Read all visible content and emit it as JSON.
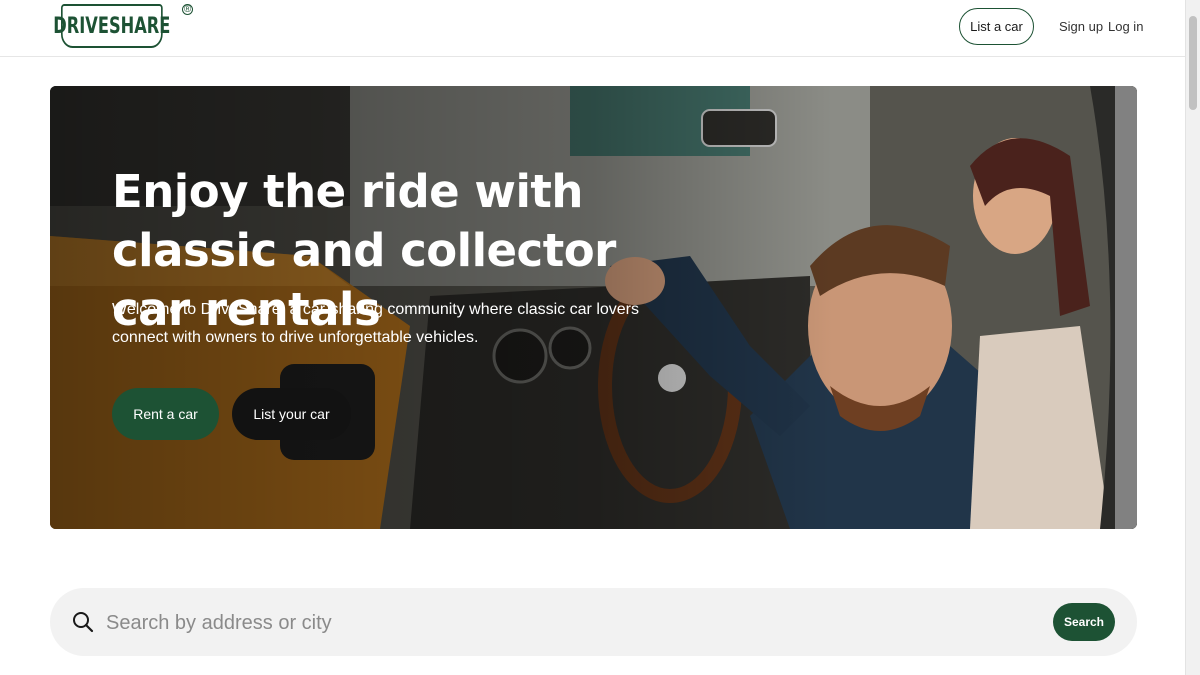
{
  "header": {
    "logo_text": "DRIVESHARE",
    "logo_mark": "®",
    "list_car_label": "List a car",
    "signup_label": "Sign up",
    "login_label": "Log in"
  },
  "hero": {
    "title": "Enjoy the ride with classic and collector car rentals",
    "subtitle": "Welcome to DriveShare, a car-sharing community where classic car lovers connect with owners to drive unforgettable vehicles.",
    "primary_cta": "Rent a car",
    "secondary_cta": "List your car"
  },
  "search": {
    "placeholder": "Search by address or city",
    "value": "",
    "button_label": "Search"
  },
  "colors": {
    "brand_green": "#1d5234",
    "dark_button": "#121212",
    "search_bg": "#f2f2f2"
  },
  "icons": {
    "search": "search-icon"
  }
}
